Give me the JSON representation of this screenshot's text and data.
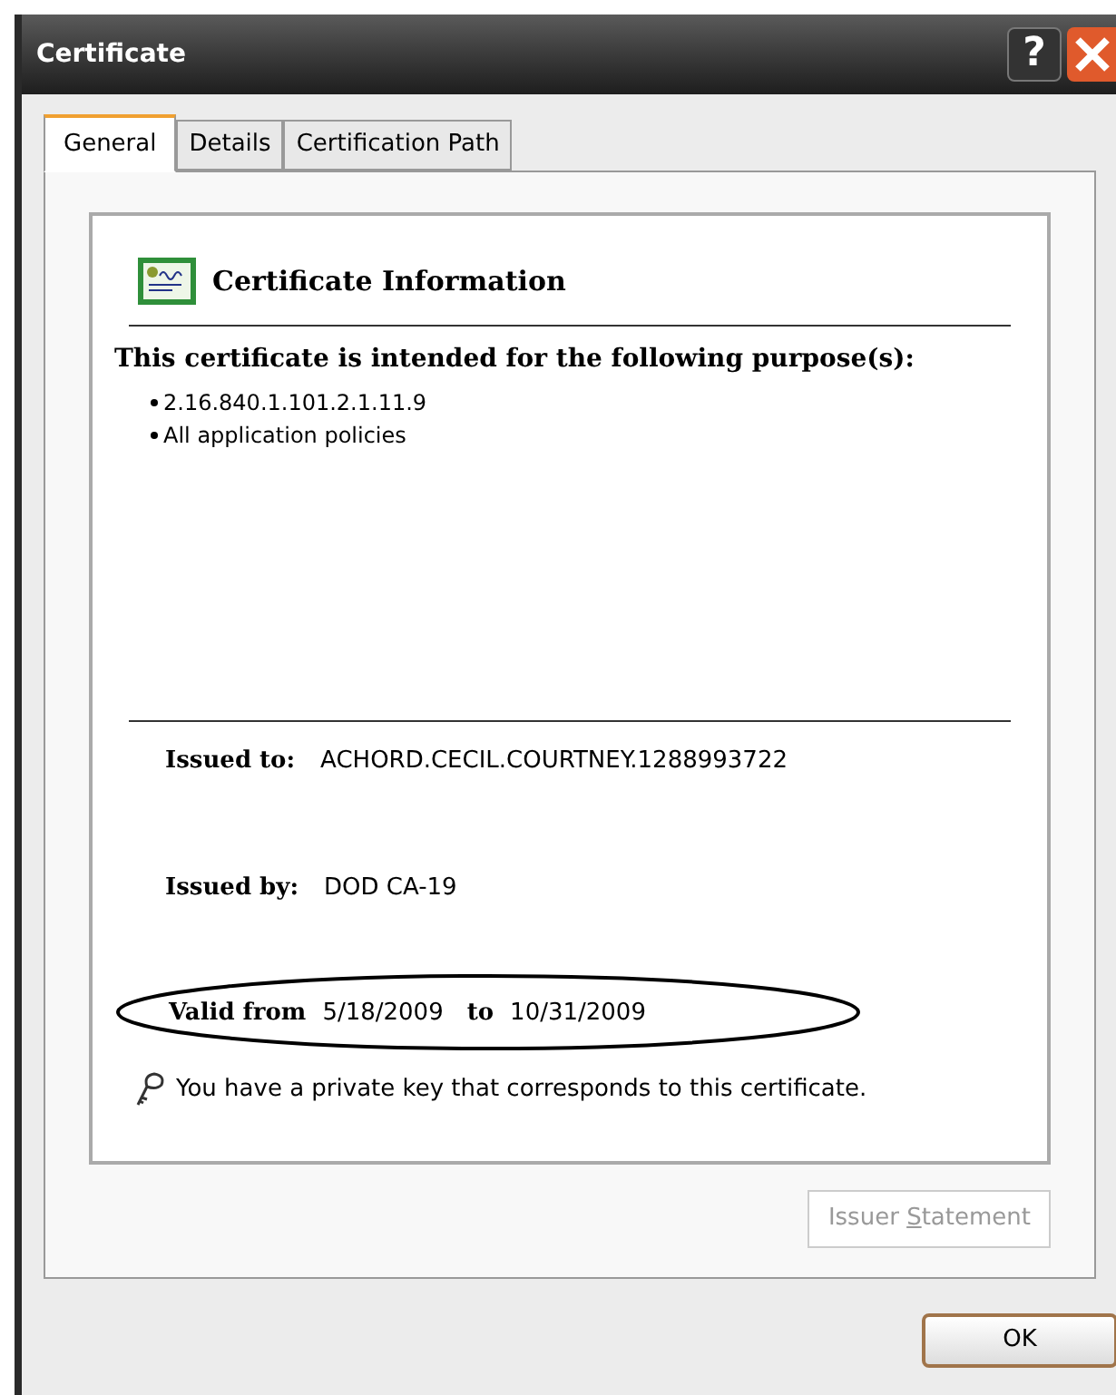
{
  "window": {
    "title": "Certificate",
    "help_button": "?"
  },
  "tabs": [
    {
      "label": "General",
      "selected": true
    },
    {
      "label": "Details",
      "selected": false
    },
    {
      "label": "Certification Path",
      "selected": false
    }
  ],
  "certificate_info": {
    "heading": "Certificate Information",
    "purpose_heading": "This certificate is intended for the following purpose(s):",
    "purposes": [
      "2.16.840.1.101.2.1.11.9",
      "All application policies"
    ],
    "issued_to_label": "Issued to:",
    "issued_to": "ACHORD.CECIL.COURTNEY.1288993722",
    "issued_by_label": "Issued by:",
    "issued_by": "DOD CA-19",
    "valid_from_label": "Valid from",
    "valid_from": "5/18/2009",
    "valid_to_label": "to",
    "valid_to": "10/31/2009",
    "private_key_note": "You have a private key that corresponds to this certificate."
  },
  "issuer_statement_button": {
    "label_before": "Issuer ",
    "mnemonic": "S",
    "label_after": "tatement",
    "disabled": true
  },
  "ok_button": "OK"
}
